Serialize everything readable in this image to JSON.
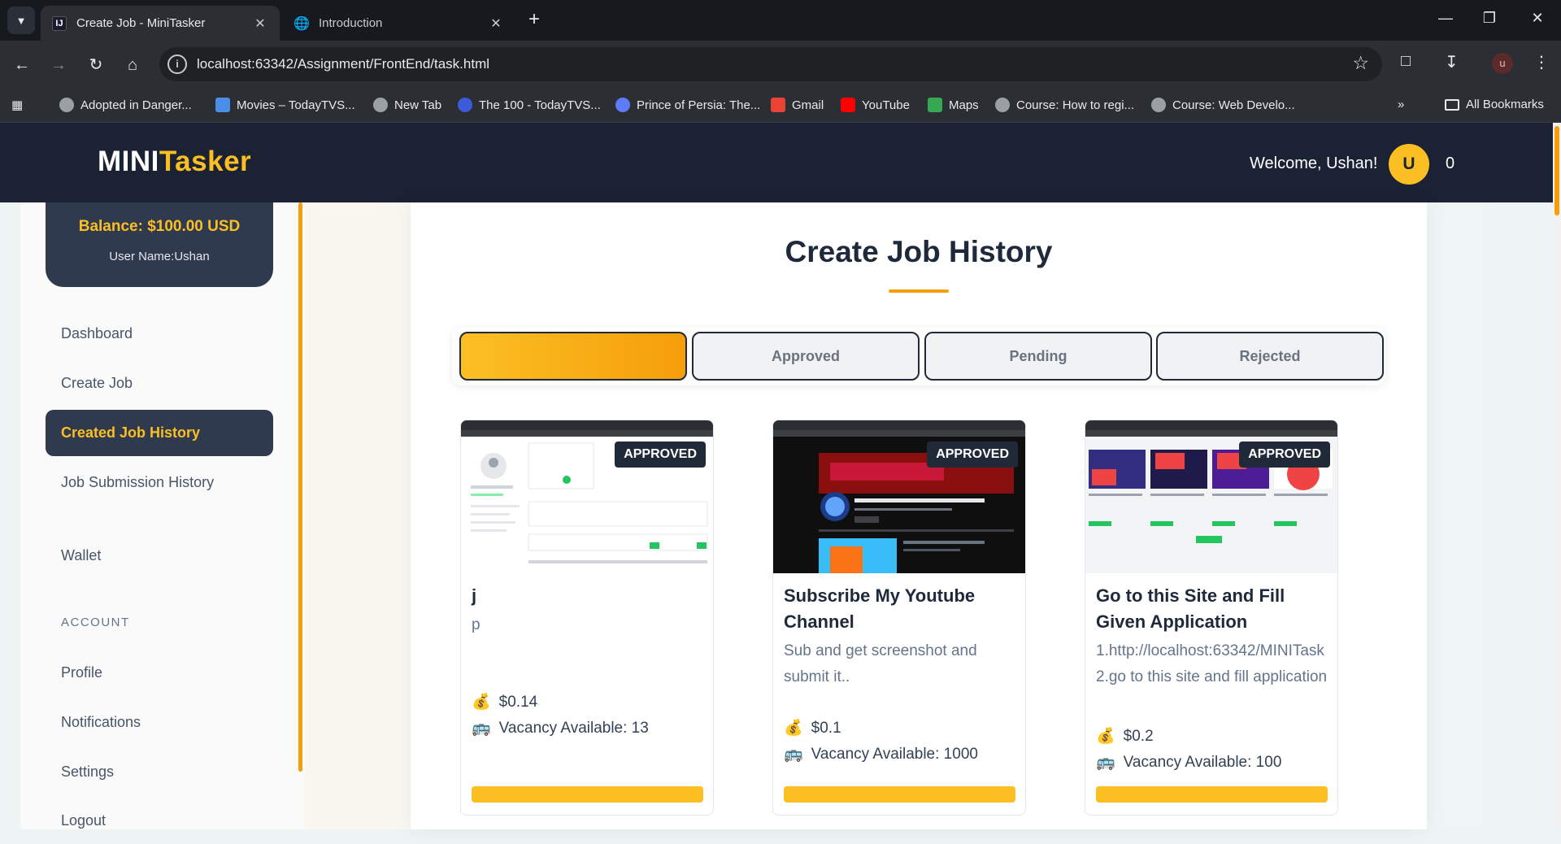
{
  "browser": {
    "tabs": [
      {
        "title": "Create Job - MiniTasker",
        "active": true
      },
      {
        "title": "Introduction",
        "active": false
      }
    ],
    "url": "localhost:63342/Assignment/FrontEnd/task.html",
    "bookmarks": [
      "Adopted in Danger...",
      "Movies – TodayTVS...",
      "New Tab",
      "The 100 - TodayTVS...",
      "Prince of Persia: The...",
      "Gmail",
      "YouTube",
      "Maps",
      "Course: How to regi...",
      "Course: Web Develo..."
    ],
    "all_bookmarks_label": "All Bookmarks",
    "profile_initial": "u"
  },
  "header": {
    "logo_part1": "MINI",
    "logo_part2": "Tasker",
    "welcome": "Welcome, Ushan!",
    "avatar_initial": "U",
    "notification_count": "0"
  },
  "sidebar": {
    "balance": "Balance: $100.00 USD",
    "username": "User Name:Ushan",
    "items": [
      {
        "label": "Dashboard"
      },
      {
        "label": "Create Job"
      },
      {
        "label": "Created Job History",
        "active": true
      },
      {
        "label": "Job Submission History"
      },
      {
        "label": "Wallet"
      }
    ],
    "account_label": "ACCOUNT",
    "account_items": [
      {
        "label": "Profile"
      },
      {
        "label": "Notifications"
      },
      {
        "label": "Settings"
      },
      {
        "label": "Logout"
      }
    ]
  },
  "main": {
    "title": "Create Job History",
    "tabs": [
      {
        "label": "",
        "active": true
      },
      {
        "label": "Approved"
      },
      {
        "label": "Pending"
      },
      {
        "label": "Rejected"
      }
    ],
    "cards": [
      {
        "status": "APPROVED",
        "title": "j",
        "description": "p",
        "price": "$0.14",
        "vacancy": "Vacancy Available: 13"
      },
      {
        "status": "APPROVED",
        "title": "Subscribe My Youtube Channel",
        "description": "Sub and get screenshot and submit it..",
        "price": "$0.1",
        "vacancy": "Vacancy Available: 1000"
      },
      {
        "status": "APPROVED",
        "title": "Go to this Site and Fill Given Application",
        "description": "1.http://localhost:63342/MINITask\n2.go to this site and fill application",
        "price": "$0.2",
        "vacancy": "Vacancy Available: 100"
      }
    ],
    "price_icon": "money-bag-icon",
    "vacancy_icon": "bus-icon"
  },
  "colors": {
    "accent": "#fbbf24",
    "header_bg": "#1b2233",
    "sidebar_active": "#2f3a4e"
  }
}
